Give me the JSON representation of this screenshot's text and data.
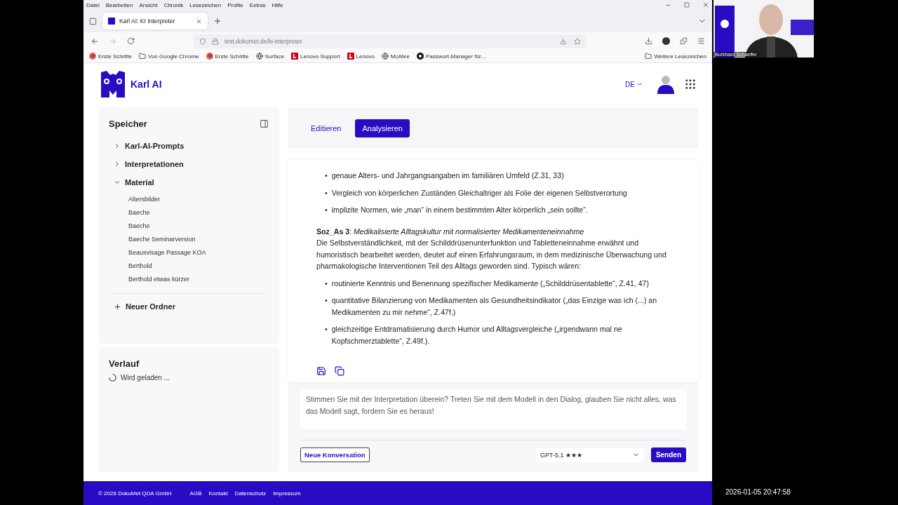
{
  "browser": {
    "menu": [
      "Datei",
      "Bearbeiten",
      "Ansicht",
      "Chronik",
      "Lesezeichen",
      "Profile",
      "Extras",
      "Hilfe"
    ],
    "tab_title": "Karl AI: KI Interpreter",
    "url": "test.dokumet.de/ki-interpreter",
    "bookmarks": [
      {
        "label": "Erste Schritte",
        "kind": "firefox"
      },
      {
        "label": "Von Google Chrome",
        "kind": "folder"
      },
      {
        "label": "Erste Schritte",
        "kind": "firefox"
      },
      {
        "label": "Surface",
        "kind": "globe"
      },
      {
        "label": "Lenovo Support",
        "kind": "badge"
      },
      {
        "label": "Lenovo",
        "kind": "badge"
      },
      {
        "label": "McAfee",
        "kind": "globe"
      },
      {
        "label": "Passwort-Manager für...",
        "kind": "key"
      }
    ],
    "more_bookmarks": "Weitere Lesezeichen"
  },
  "app": {
    "brand": "Karl AI",
    "language": "DE"
  },
  "sidebar": {
    "title": "Speicher",
    "folders": [
      {
        "label": "Karl-AI-Prompts",
        "expanded": false
      },
      {
        "label": "Interpretationen",
        "expanded": false
      },
      {
        "label": "Material",
        "expanded": true,
        "children": [
          {
            "label": "Altersbilder"
          },
          {
            "label": "Baeche"
          },
          {
            "label": "Baeche"
          },
          {
            "label": "Baeche Seminarversion"
          },
          {
            "label": "Beausvisage Passage KOA"
          },
          {
            "label": "Berthold"
          },
          {
            "label": "Berthold etwas kürzer"
          }
        ]
      }
    ],
    "new_folder": "Neuer Ordner"
  },
  "history": {
    "title": "Verlauf",
    "status": "Wird geladen ..."
  },
  "tabs": [
    {
      "label": "Editieren",
      "selected": false
    },
    {
      "label": "Analysieren",
      "selected": true
    }
  ],
  "content": [
    {
      "kind": "list",
      "marker": "•",
      "items": [
        "genaue Alters- und Jahrgangsangaben im familiären Umfeld (Z.31, 33)",
        "Vergleich von körperlichen Zuständen Gleichaltriger als Folie der eigenen Selbstverortung",
        "implizite Normen, wie „man“ in einem bestimmten Alter körperlich „sein sollte“."
      ]
    },
    {
      "kind": "heading",
      "text": "**Soz_As 3**: *Medikalisierte Alltagskultur mit normalisierter Medikamenteneinnahme*"
    },
    {
      "kind": "paragraph",
      "text": "Die Selbstverständlichkeit, mit der Schilddrüsenunterfunktion und Tabletteneinnahme erwähnt und humoristisch bearbeitet werden, deutet auf einen Erfahrungsraum, in dem medizinische Überwachung und pharmakologische Interventionen Teil des Alltags geworden sind. Typisch wären:"
    },
    {
      "kind": "list",
      "marker": "•",
      "items": [
        "routinierte Kenntnis und Benennung spezifischer Medikamente („Schilddrüsentablette“, Z.41, 47)",
        "quantitative Bilanzierung von Medikamenten als Gesundheitsindikator („das Einzige was ich (...) an Medikamenten zu mir nehme“, Z.47f.)",
        "gleichzeitige Entdramatisierung durch Humor und Alltagsvergleiche („irgendwann mal ne Kopfschmerztablette“, Z.49f.)."
      ]
    }
  ],
  "prompt": {
    "placeholder": "Stimmen Sie mit der Interpretation überein? Treten Sie mit dem Modell in den Dialog, glauben Sie nicht alles, was das Modell sagt, fordern Sie es heraus!"
  },
  "new_conversation": "Neue Konversation",
  "model": "GPT-5.1 ★★★",
  "send": "Senden",
  "footer": {
    "copyright": "© 2026 DokuMet QDA GmbH",
    "links": [
      "AGB",
      "Kontakt",
      "Datenschutz",
      "Impressum"
    ]
  },
  "webcam": {
    "name": "Burkhard Schaeffer"
  },
  "timestamp": "2026-01-05 20:47:58"
}
